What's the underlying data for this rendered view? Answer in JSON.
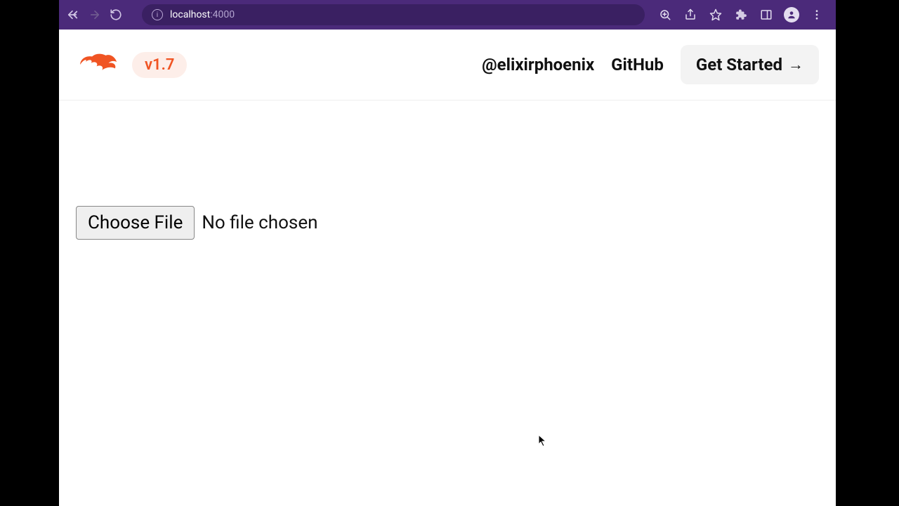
{
  "browser": {
    "url_host": "localhost",
    "url_port": ":4000"
  },
  "header": {
    "version": "v1.7",
    "nav": {
      "twitter": "@elixirphoenix",
      "github": "GitHub",
      "get_started": "Get Started"
    }
  },
  "main": {
    "file_input": {
      "button_label": "Choose File",
      "status": "No file chosen"
    }
  }
}
